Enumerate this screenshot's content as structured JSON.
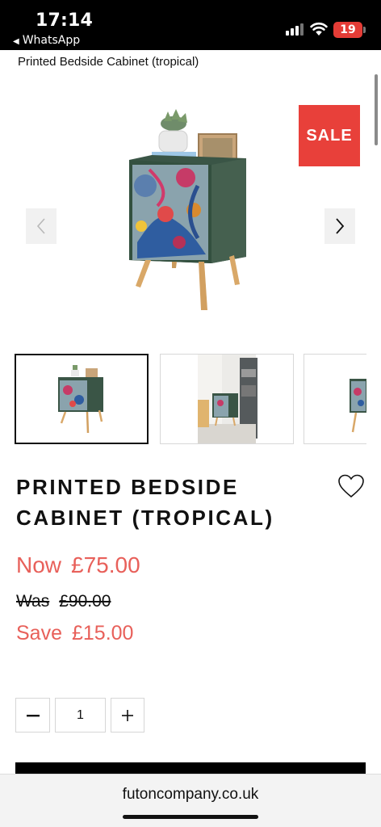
{
  "status_bar": {
    "time": "17:14",
    "back_app": "WhatsApp",
    "battery": "19"
  },
  "page": {
    "breadcrumb_title": "Printed Bedside Cabinet (tropical)",
    "scroll_position": 0.05
  },
  "gallery": {
    "sale_badge": "SALE",
    "prev_icon": "chevron-left-icon",
    "next_icon": "chevron-right-icon",
    "thumbnail_count_visible": 3,
    "active_thumbnail": 1
  },
  "product": {
    "title": "PRINTED BEDSIDE CABINET (TROPICAL)",
    "wishlist_icon": "heart-outline-icon",
    "price_now_label": "Now",
    "price_now": "£75.00",
    "price_was_label": "Was",
    "price_was": "£90.00",
    "price_save_label": "Save",
    "price_save": "£15.00"
  },
  "quantity": {
    "minus": "−",
    "value": "1",
    "plus": "+"
  },
  "browser": {
    "url": "futoncompany.co.uk"
  },
  "colors": {
    "sale_red": "#e8403a",
    "price_red": "#e8605a",
    "cabinet_green": "#3f5a4c",
    "leg_wood": "#d9a868"
  }
}
